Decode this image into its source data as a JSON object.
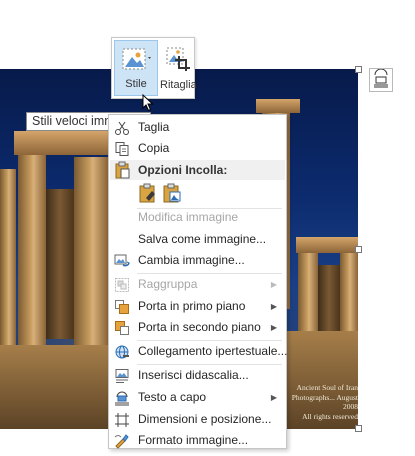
{
  "mini_toolbar": {
    "style_label": "Stile",
    "crop_label": "Ritaglia"
  },
  "tooltip": "Stili veloci immagine",
  "image": {
    "copyright_lines": [
      "Ancient Soul of Iran",
      "Photographs... August 2008",
      "All rights reserved"
    ]
  },
  "context_menu": {
    "cut": "Taglia",
    "copy": "Copia",
    "paste_header": "Opzioni Incolla:",
    "edit_image": "Modifica immagine",
    "save_as_image": "Salva come immagine...",
    "change_image": "Cambia immagine...",
    "group": "Raggruppa",
    "bring_front": "Porta in primo piano",
    "send_back": "Porta in secondo piano",
    "hyperlink": "Collegamento ipertestuale...",
    "insert_caption": "Inserisci didascalia...",
    "wrap_text": "Testo a capo",
    "size_position": "Dimensioni e posizione...",
    "format_image": "Formato immagine..."
  },
  "colors": {
    "toolbar_selected": "#cde4f7",
    "disabled_text": "#a6a6a6",
    "icon_blue": "#2b6cb5",
    "icon_orange": "#e6a23c"
  },
  "icons": [
    "picture-styles-icon",
    "crop-icon",
    "layout-options-icon",
    "cut-icon",
    "copy-icon",
    "paste-icon",
    "paste-keep-format-icon",
    "paste-picture-icon",
    "change-picture-icon",
    "group-icon",
    "bring-forward-icon",
    "send-backward-icon",
    "hyperlink-icon",
    "insert-caption-icon",
    "wrap-text-icon",
    "size-position-icon",
    "format-picture-icon",
    "mouse-cursor-icon"
  ]
}
